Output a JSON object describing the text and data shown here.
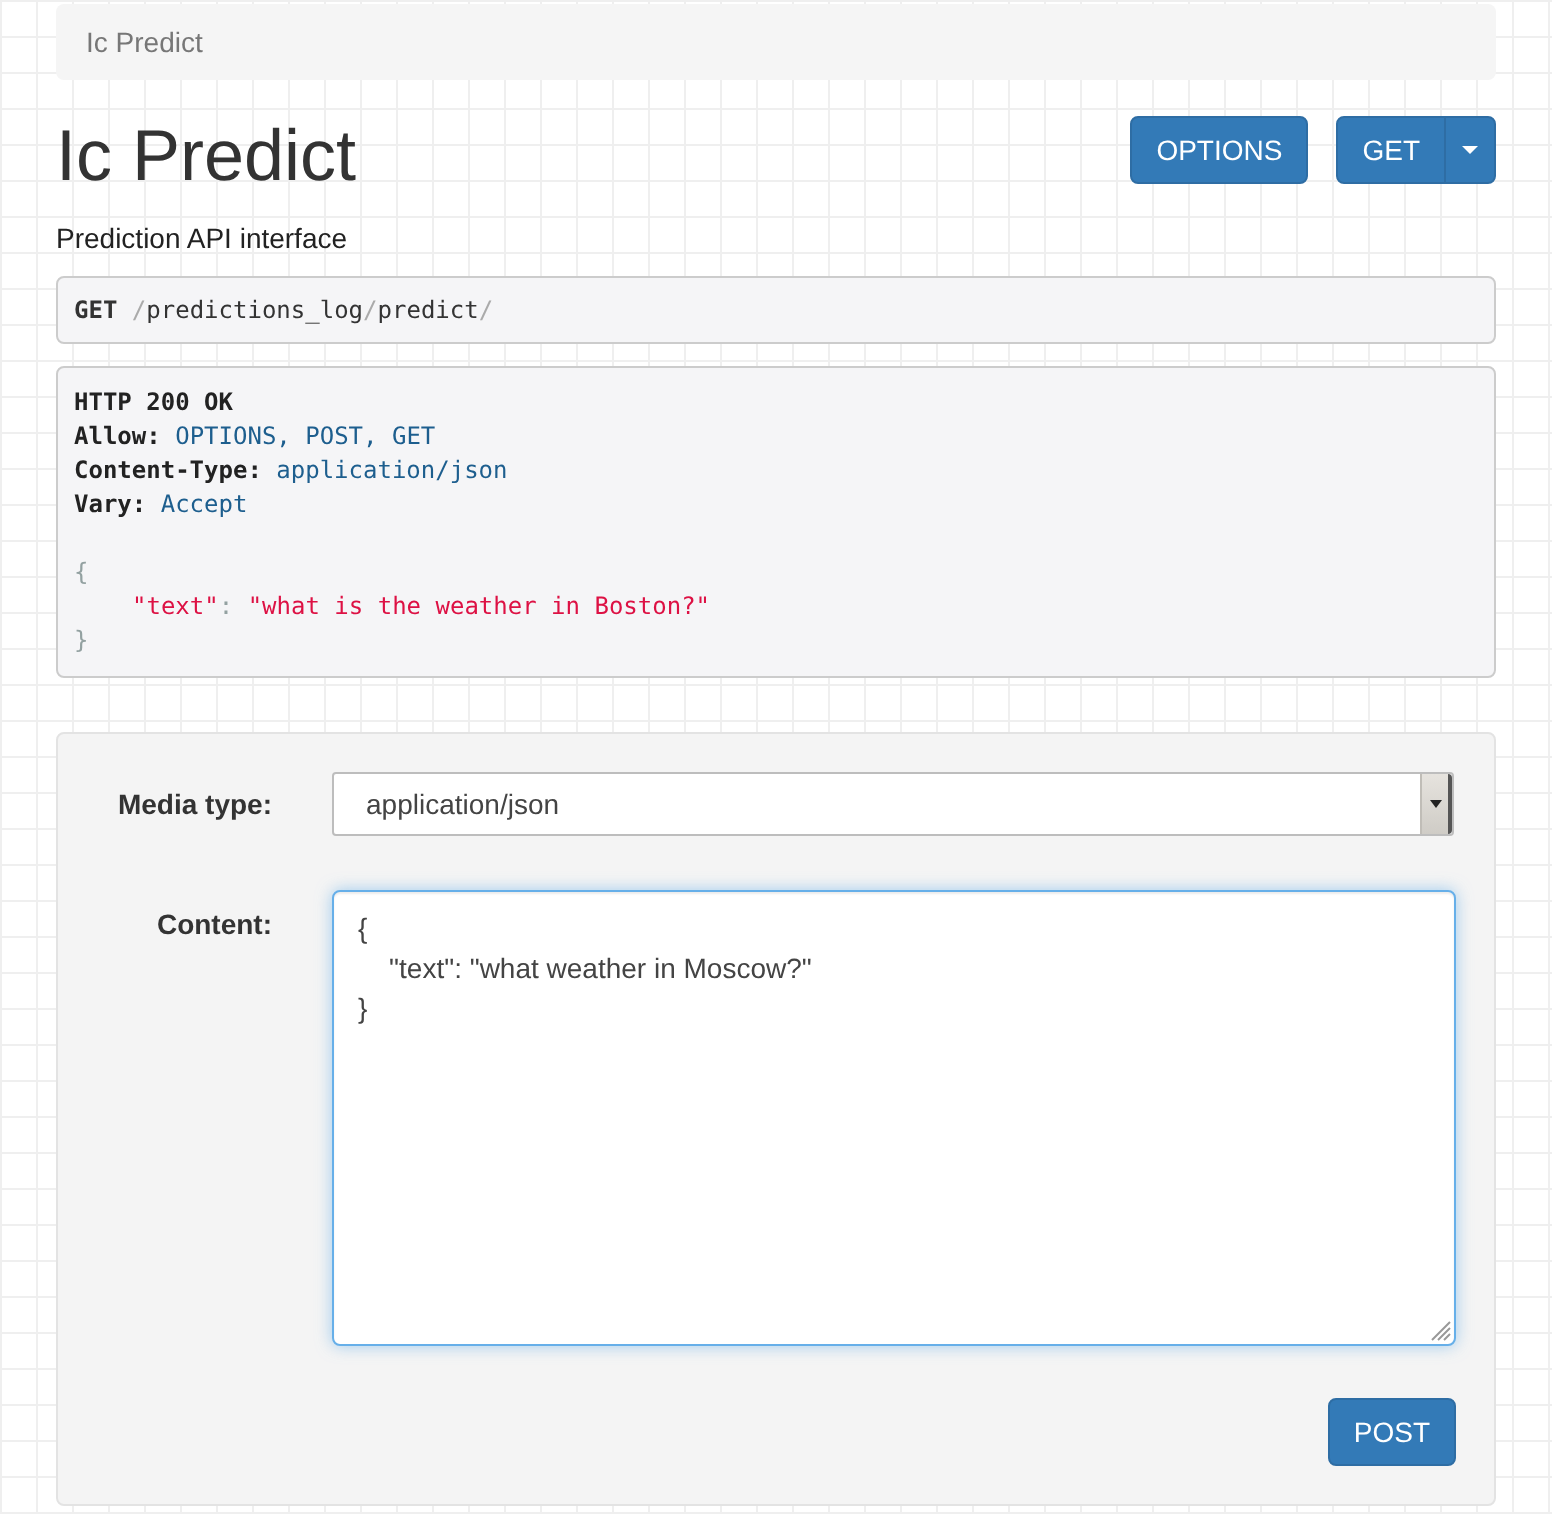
{
  "breadcrumb": [
    {
      "label": "Ic Predict",
      "selected": true
    }
  ],
  "header": {
    "title": "Ic Predict",
    "description": "Prediction API interface"
  },
  "actions": [
    {
      "kind": "button",
      "label": "OPTIONS"
    },
    {
      "kind": "split",
      "label": "GET"
    }
  ],
  "request": {
    "method": "GET",
    "path": "/predictions_log/predict/"
  },
  "response": {
    "status": "HTTP 200 OK",
    "headers": [
      {
        "name": "Allow:",
        "value": "OPTIONS, POST, GET"
      },
      {
        "name": "Content-Type:",
        "value": "application/json"
      },
      {
        "name": "Vary:",
        "value": "Accept"
      }
    ],
    "body": {
      "open": "{",
      "fields": [
        {
          "key": "\"text\"",
          "separator": ":",
          "value": "\"what is the weather in Boston?\""
        }
      ],
      "close": "}"
    }
  },
  "form": {
    "fields": [
      {
        "kind": "select",
        "label": "Media type:",
        "value": "application/json"
      },
      {
        "kind": "textarea",
        "label": "Content:",
        "value": "{\n    \"text\": \"what weather in Moscow?\"\n}",
        "focused": true
      }
    ],
    "submit": {
      "label": "POST"
    }
  }
}
